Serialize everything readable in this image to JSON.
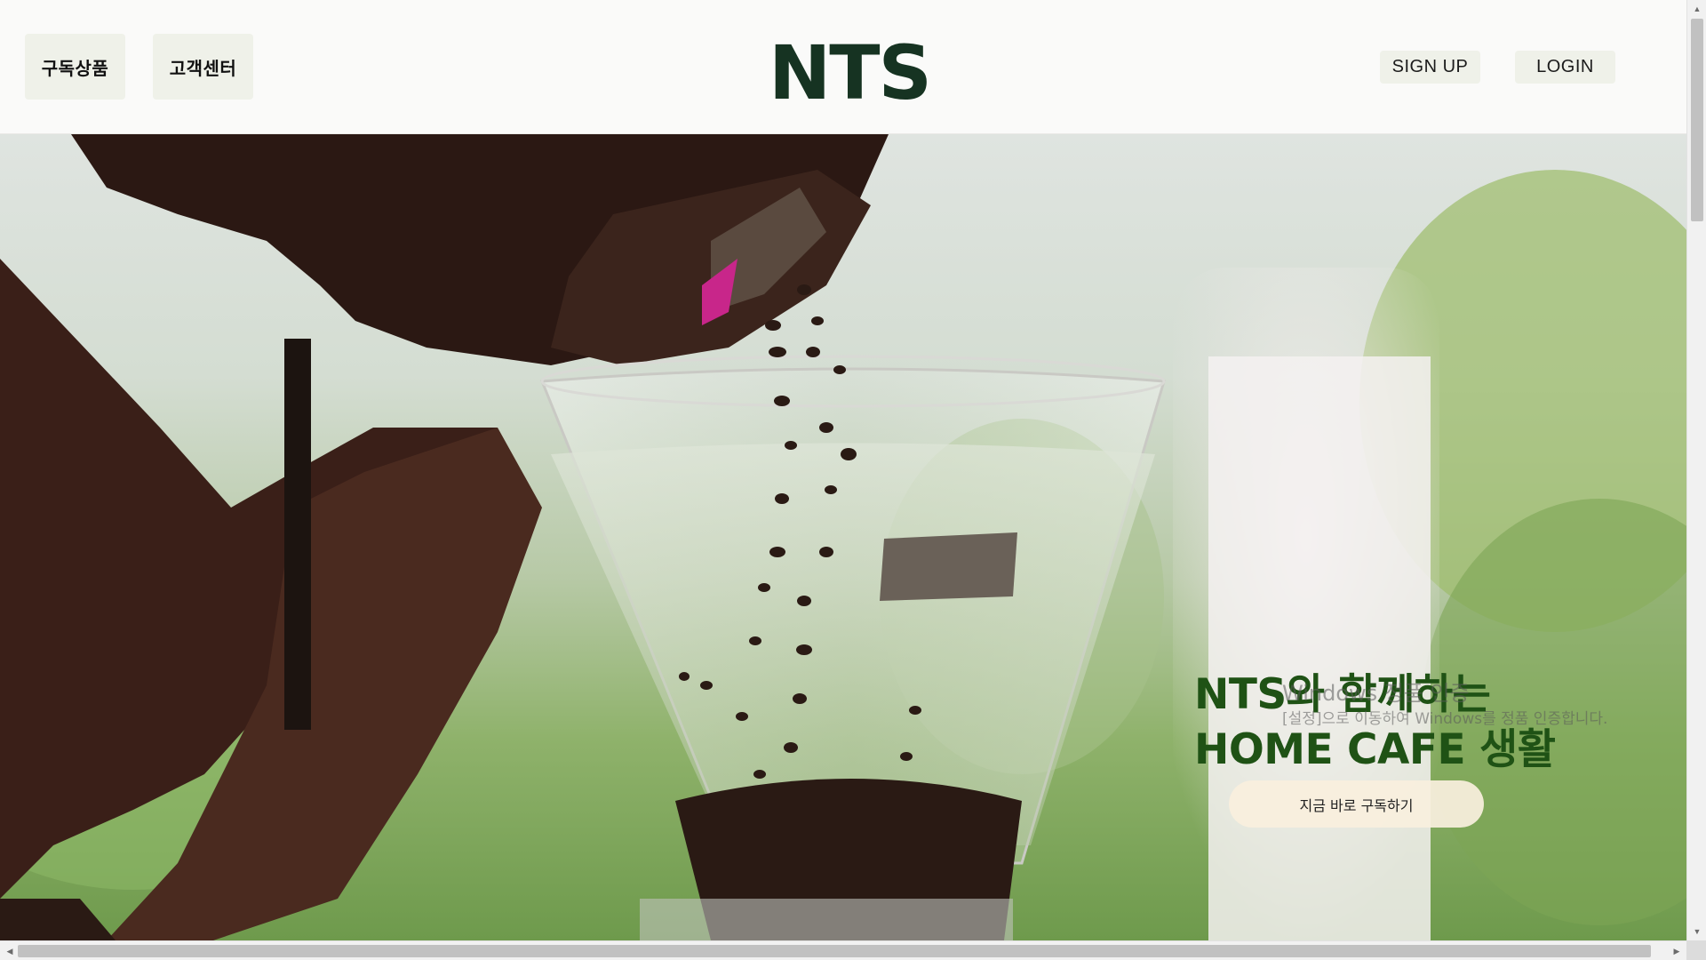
{
  "header": {
    "nav": [
      {
        "label": "구독상품"
      },
      {
        "label": "고객센터"
      }
    ],
    "logo": "NTS",
    "auth": {
      "signup_label": "SIGN UP",
      "login_label": "LOGIN"
    }
  },
  "hero": {
    "title_line1": "NTS와 함께하는",
    "title_line2": "HOME CAFE 생활",
    "cta_label": "지금 바로 구독하기",
    "image_icon": "coffee-beans-pouring-into-grinder-hopper"
  },
  "windows_watermark": {
    "line1": "Windows 정품 인증",
    "line2": "[설정]으로 이동하여 Windows를 정품 인증합니다."
  },
  "colors": {
    "logo": "#163322",
    "hero_title": "#1f5215",
    "button_bg": "#eff1e9",
    "cta_bg": "#f9efde"
  }
}
